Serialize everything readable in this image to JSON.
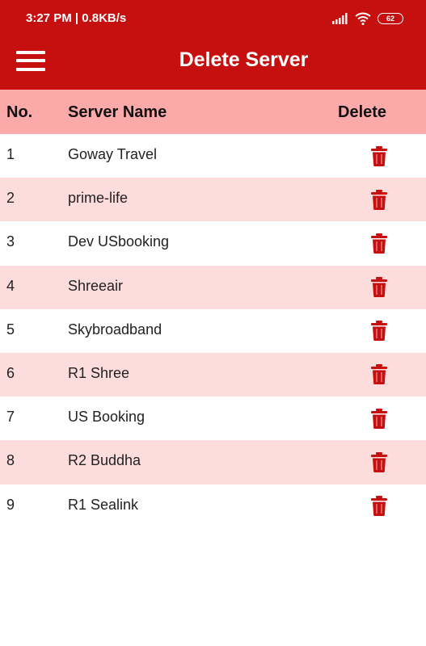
{
  "status_bar": {
    "time": "3:27 PM | 0.8KB/s",
    "battery": "62"
  },
  "app_bar": {
    "title": "Delete Server",
    "menu_icon": "hamburger-menu-icon"
  },
  "table": {
    "headers": {
      "no": "No.",
      "name": "Server Name",
      "delete": "Delete"
    },
    "delete_icon": "trash-icon",
    "rows": [
      {
        "no": "1",
        "name": "Goway Travel"
      },
      {
        "no": "2",
        "name": "prime-life"
      },
      {
        "no": "3",
        "name": "Dev USbooking"
      },
      {
        "no": "4",
        "name": "Shreeair"
      },
      {
        "no": "5",
        "name": "Skybroadband"
      },
      {
        "no": "6",
        "name": "R1 Shree"
      },
      {
        "no": "7",
        "name": "US Booking"
      },
      {
        "no": "8",
        "name": "R2 Buddha"
      },
      {
        "no": "9",
        "name": "R1 Sealink"
      }
    ]
  },
  "colors": {
    "primary": "#c60f0f",
    "header_bg": "#fca9a9",
    "alt_row_bg": "#fddcdc",
    "delete_icon": "#c60f0f"
  }
}
